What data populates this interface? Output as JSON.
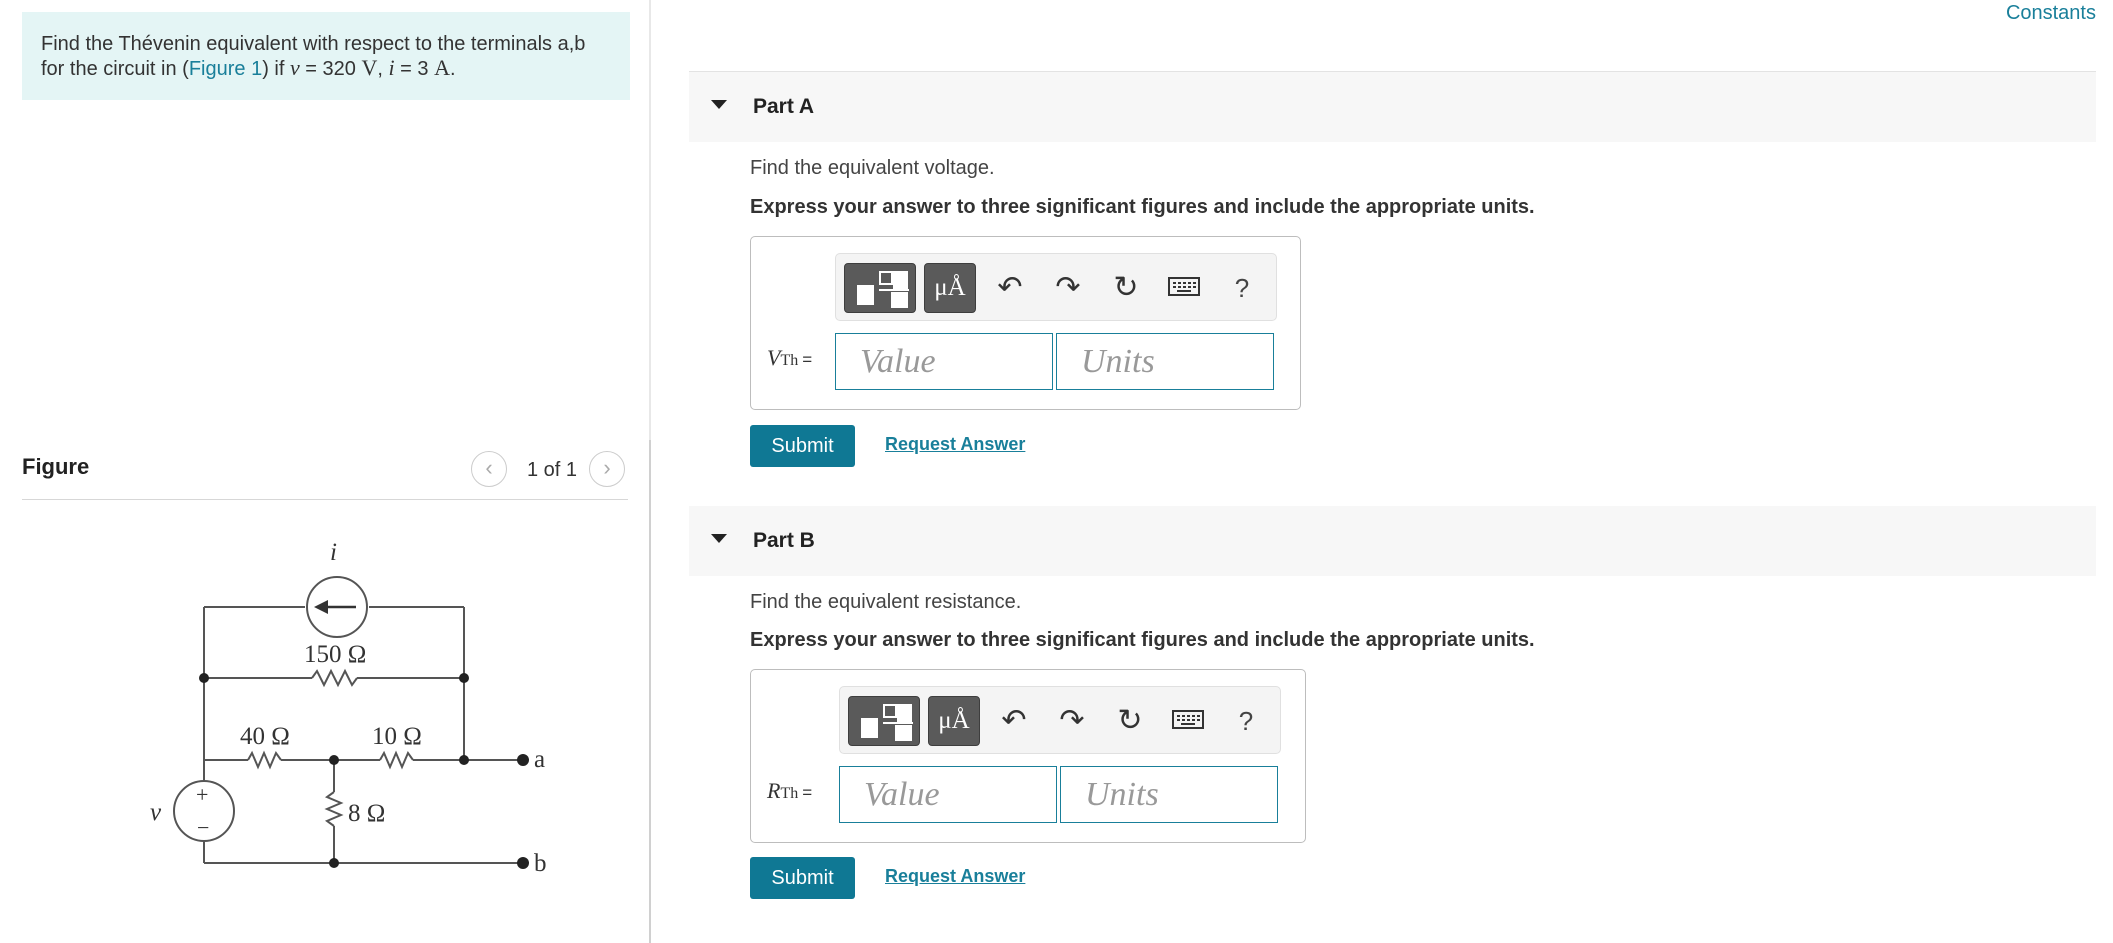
{
  "problem": {
    "text_before": "Find the Thévenin equivalent with respect to the terminals a,b for the circuit in (",
    "figure_link": "Figure 1",
    "text_after": ") if ",
    "v_var": "v",
    "v_eq": " = 320 ",
    "v_unit": "V",
    "comma": ", ",
    "i_var": "i",
    "i_eq": " = 3 ",
    "i_unit": "A",
    "period": "."
  },
  "figure": {
    "title": "Figure",
    "counter": "1 of 1",
    "prev_icon": "chevron-left-icon",
    "next_icon": "chevron-right-icon"
  },
  "circuit": {
    "source_current_label": "i",
    "source_voltage_label": "v",
    "r1": "150 Ω",
    "r2": "40 Ω",
    "r3": "10 Ω",
    "r4": "8 Ω",
    "terminal_a": "a",
    "terminal_b": "b",
    "plus": "+",
    "minus": "−"
  },
  "constants_link": "Constants",
  "parts": [
    {
      "title": "Part A",
      "prompt": "Find the equivalent voltage.",
      "instruction": "Express your answer to three significant figures and include the appropriate units.",
      "var_main": "V",
      "var_sub": "Th",
      "equals": "=",
      "value_placeholder": "Value",
      "units_placeholder": "Units",
      "submit": "Submit",
      "request": "Request Answer"
    },
    {
      "title": "Part B",
      "prompt": "Find the equivalent resistance.",
      "instruction": "Express your answer to three significant figures and include the appropriate units.",
      "var_main": "R",
      "var_sub": "Th",
      "equals": "=",
      "value_placeholder": "Value",
      "units_placeholder": "Units",
      "submit": "Submit",
      "request": "Request Answer"
    }
  ],
  "toolbar": {
    "units_label": "μÅ",
    "undo": "↶",
    "redo": "↷",
    "reset": "↻",
    "help": "?",
    "icons": [
      "templates-icon",
      "units-icon",
      "undo-icon",
      "redo-icon",
      "reset-icon",
      "keyboard-icon",
      "help-icon"
    ]
  },
  "colors": {
    "accent": "#197f9a",
    "button": "#0f7894",
    "problem_bg": "#e4f5f5"
  }
}
